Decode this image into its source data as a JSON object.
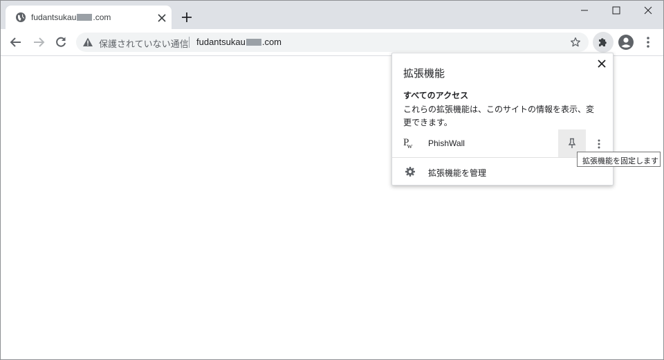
{
  "tab": {
    "title_prefix": "fudantsukau",
    "title_suffix": ".com"
  },
  "omnibox": {
    "security_text": "保護されていない通信",
    "url_prefix": "fudantsukau",
    "url_suffix": ".com"
  },
  "popup": {
    "title": "拡張機能",
    "section_heading": "すべてのアクセス",
    "section_description": "これらの拡張機能は、このサイトの情報を表示、変更できます。",
    "extension_name": "PhishWall",
    "extension_icon_letters": [
      "P",
      "w"
    ],
    "manage_label": "拡張機能を管理"
  },
  "tooltip": {
    "text": "拡張機能を固定します"
  },
  "icons": {
    "favicon": "globe-icon",
    "security": "warning-icon",
    "bookmark": "star-icon",
    "extensions": "puzzle-icon",
    "profile": "account-icon",
    "menu": "kebab-icon",
    "pin": "pin-icon",
    "manage": "gear-icon"
  },
  "colors": {
    "tabstrip": "#dee1e6",
    "omnibox": "#f1f3f4",
    "pin_hover": "#ebebeb"
  }
}
